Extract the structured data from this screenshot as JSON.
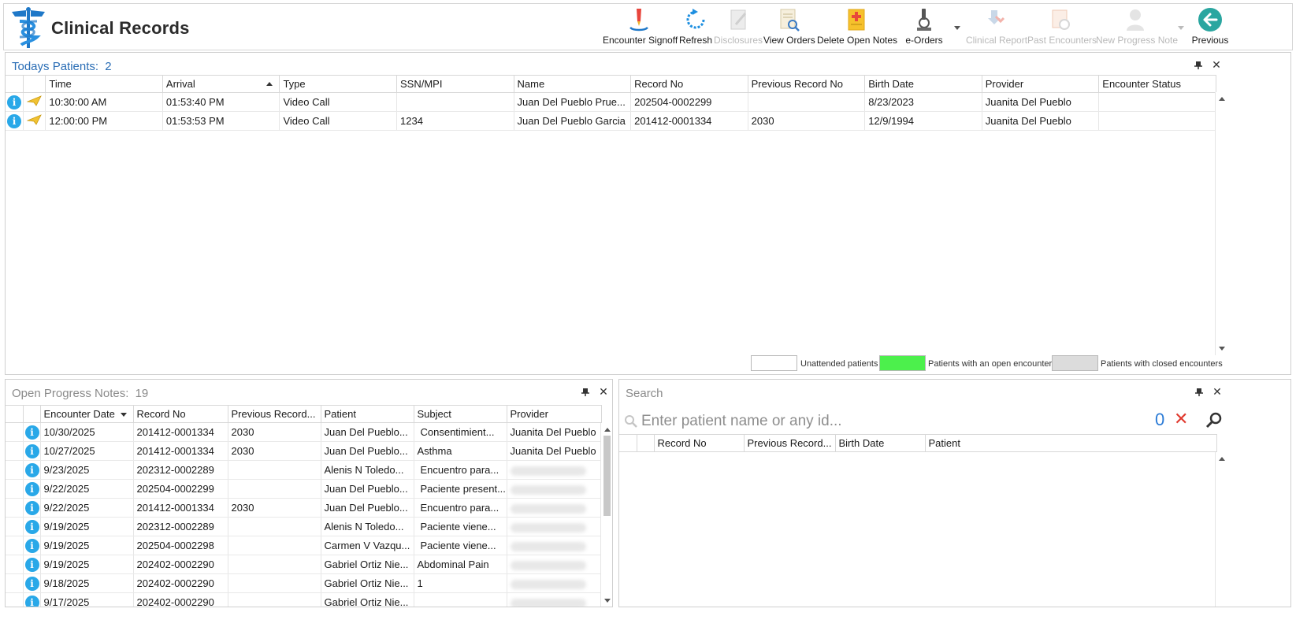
{
  "app": {
    "title": "Clinical Records",
    "logo_icon": "caduceus-icon"
  },
  "toolbar": {
    "items": [
      {
        "label": "Encounter Signoff",
        "icon": "signoff-pen-icon",
        "enabled": true
      },
      {
        "label": "Refresh",
        "icon": "refresh-icon",
        "enabled": true
      },
      {
        "label": "Disclosures",
        "icon": "disclosures-icon",
        "enabled": false
      },
      {
        "label": "View Orders",
        "icon": "view-orders-icon",
        "enabled": true
      },
      {
        "label": "Delete Open Notes",
        "icon": "delete-notes-icon",
        "enabled": true
      },
      {
        "label": "e-Orders",
        "icon": "microscope-icon",
        "enabled": true
      },
      {
        "label": "Clinical Report",
        "icon": "clinical-report-icon",
        "enabled": false
      },
      {
        "label": "Past Encounters",
        "icon": "past-encounters-icon",
        "enabled": false
      },
      {
        "label": "New Progress Note",
        "icon": "new-note-icon",
        "enabled": false
      },
      {
        "label": "Previous",
        "icon": "back-arrow-icon",
        "enabled": true
      }
    ]
  },
  "todays_patients": {
    "title": "Todays Patients:",
    "count": "2",
    "columns": [
      "Time",
      "Arrival",
      "Type",
      "SSN/MPI",
      "Name",
      "Record No",
      "Previous Record No",
      "Birth Date",
      "Provider",
      "Encounter Status"
    ],
    "rows": [
      {
        "time": "10:30:00 AM",
        "arrival": "01:53:40 PM",
        "type": "Video Call",
        "ssn": "",
        "name": "Juan Del Pueblo Prue...",
        "record_no": "202504-0002299",
        "prev_record": "",
        "birth_date": "8/23/2023",
        "provider": "Juanita Del Pueblo",
        "status": ""
      },
      {
        "time": "12:00:00 PM",
        "arrival": "01:53:53 PM",
        "type": "Video Call",
        "ssn": "1234",
        "name": "Juan Del Pueblo Garcia",
        "record_no": "201412-0001334",
        "prev_record": "2030",
        "birth_date": "12/9/1994",
        "provider": "Juanita Del Pueblo",
        "status": ""
      }
    ],
    "legend": [
      {
        "label": "Unattended patients",
        "color": "#ffffff"
      },
      {
        "label": "Patients with an open encounter",
        "color": "#4cf04c"
      },
      {
        "label": "Patients with closed encounters",
        "color": "#dcdcdc"
      }
    ]
  },
  "open_progress_notes": {
    "title": "Open Progress Notes:",
    "count": "19",
    "columns": [
      "Encounter Date",
      "Record No",
      "Previous Record...",
      "Patient",
      "Subject",
      "Provider"
    ],
    "rows": [
      {
        "date": "10/30/2025",
        "record_no": "201412-0001334",
        "prev_record": "2030",
        "patient": "Juan Del Pueblo...",
        "subject": "Consentimient...",
        "provider": "Juanita Del Pueblo",
        "subject_indent": true
      },
      {
        "date": "10/27/2025",
        "record_no": "201412-0001334",
        "prev_record": "2030",
        "patient": "Juan Del Pueblo...",
        "subject": "Asthma",
        "provider": "Juanita Del Pueblo",
        "subject_indent": false
      },
      {
        "date": "9/23/2025",
        "record_no": "202312-0002289",
        "prev_record": "",
        "patient": "Alenis N Toledo...",
        "subject": "Encuentro para...",
        "provider": "",
        "subject_indent": true
      },
      {
        "date": "9/22/2025",
        "record_no": "202504-0002299",
        "prev_record": "",
        "patient": "Juan Del Pueblo...",
        "subject": "Paciente present...",
        "provider": "",
        "subject_indent": true
      },
      {
        "date": "9/22/2025",
        "record_no": "201412-0001334",
        "prev_record": "2030",
        "patient": "Juan Del Pueblo...",
        "subject": "Encuentro para...",
        "provider": "",
        "subject_indent": true
      },
      {
        "date": "9/19/2025",
        "record_no": "202312-0002289",
        "prev_record": "",
        "patient": "Alenis N Toledo...",
        "subject": "Paciente viene...",
        "provider": "",
        "subject_indent": true
      },
      {
        "date": "9/19/2025",
        "record_no": "202504-0002298",
        "prev_record": "",
        "patient": "Carmen V Vazqu...",
        "subject": "Paciente viene...",
        "provider": "",
        "subject_indent": true
      },
      {
        "date": "9/19/2025",
        "record_no": "202402-0002290",
        "prev_record": "",
        "patient": "Gabriel Ortiz Nie...",
        "subject": "Abdominal Pain",
        "provider": "",
        "subject_indent": false
      },
      {
        "date": "9/18/2025",
        "record_no": "202402-0002290",
        "prev_record": "",
        "patient": "Gabriel Ortiz Nie...",
        "subject": "1",
        "provider": "",
        "subject_indent": false
      },
      {
        "date": "9/17/2025",
        "record_no": "202402-0002290",
        "prev_record": "",
        "patient": "Gabriel Ortiz Nie...",
        "subject": "",
        "provider": "",
        "subject_indent": false
      }
    ]
  },
  "search": {
    "title": "Search",
    "placeholder": "Enter patient name or any id...",
    "count": "0",
    "columns": [
      "Record No",
      "Previous Record...",
      "Birth Date",
      "Patient"
    ]
  }
}
